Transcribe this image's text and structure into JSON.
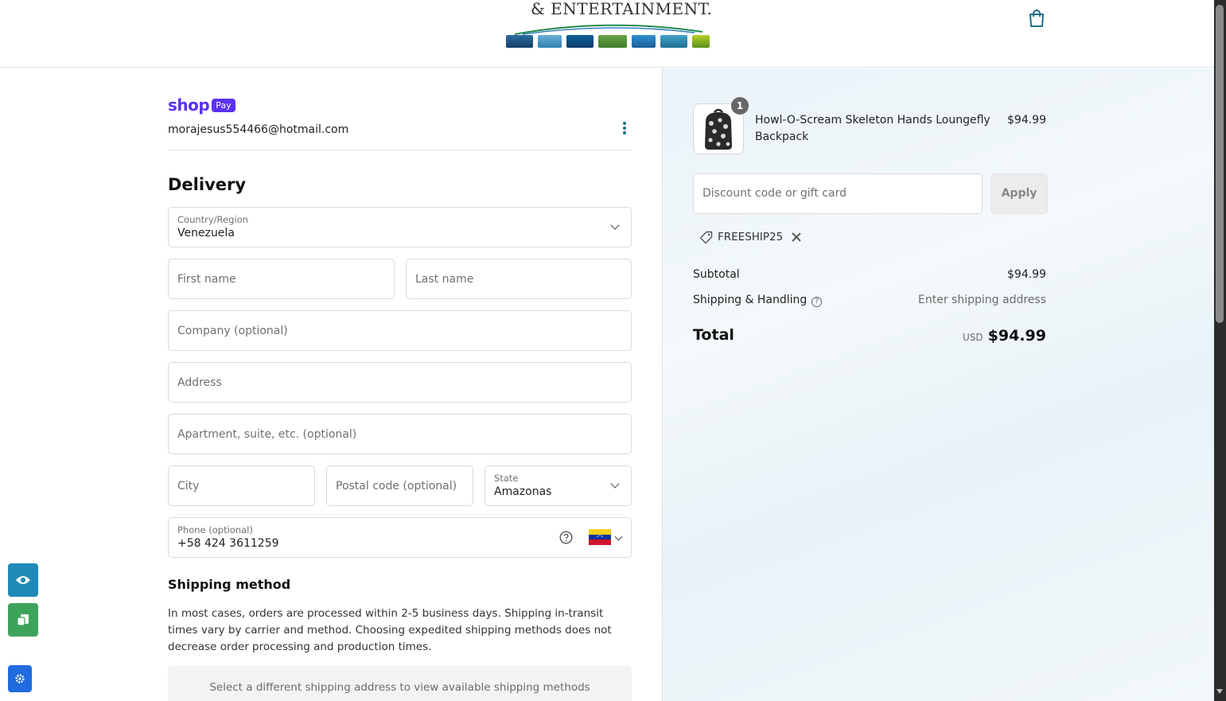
{
  "header": {
    "brand_text": "& ENTERTAINMENT.",
    "cart_icon": "shopping-bag-icon"
  },
  "account": {
    "shop_word": "shop",
    "pay_badge": "Pay",
    "email": "morajesus554466@hotmail.com",
    "menu_icon": "kebab-menu-icon"
  },
  "delivery": {
    "heading": "Delivery",
    "country_label": "Country/Region",
    "country_value": "Venezuela",
    "first_name_placeholder": "First name",
    "last_name_placeholder": "Last name",
    "company_placeholder": "Company (optional)",
    "address_placeholder": "Address",
    "apartment_placeholder": "Apartment, suite, etc. (optional)",
    "city_placeholder": "City",
    "postal_placeholder": "Postal code (optional)",
    "state_label": "State",
    "state_value": "Amazonas",
    "phone_label": "Phone (optional)",
    "phone_value": "+58 424 3611259"
  },
  "shipping": {
    "heading": "Shipping method",
    "description": "In most cases, orders are processed within 2-5 business days. Shipping in-transit times vary by carrier and method. Choosing expedited shipping methods does not decrease order processing and production times.",
    "notice": "Select a different shipping address to view available shipping methods"
  },
  "order": {
    "item": {
      "quantity": "1",
      "name": "Howl-O-Scream Skeleton Hands Loungefly Backpack",
      "price": "$94.99"
    },
    "discount_placeholder": "Discount code or gift card",
    "apply_label": "Apply",
    "applied_code": "FREESHIP25",
    "subtotal_label": "Subtotal",
    "subtotal_value": "$94.99",
    "shipping_label": "Shipping & Handling",
    "shipping_value": "Enter shipping address",
    "total_label": "Total",
    "total_currency": "USD",
    "total_value": "$94.99"
  },
  "colors": {
    "shop_purple": "#5a31f4",
    "accent_teal": "#1f6f8b"
  }
}
